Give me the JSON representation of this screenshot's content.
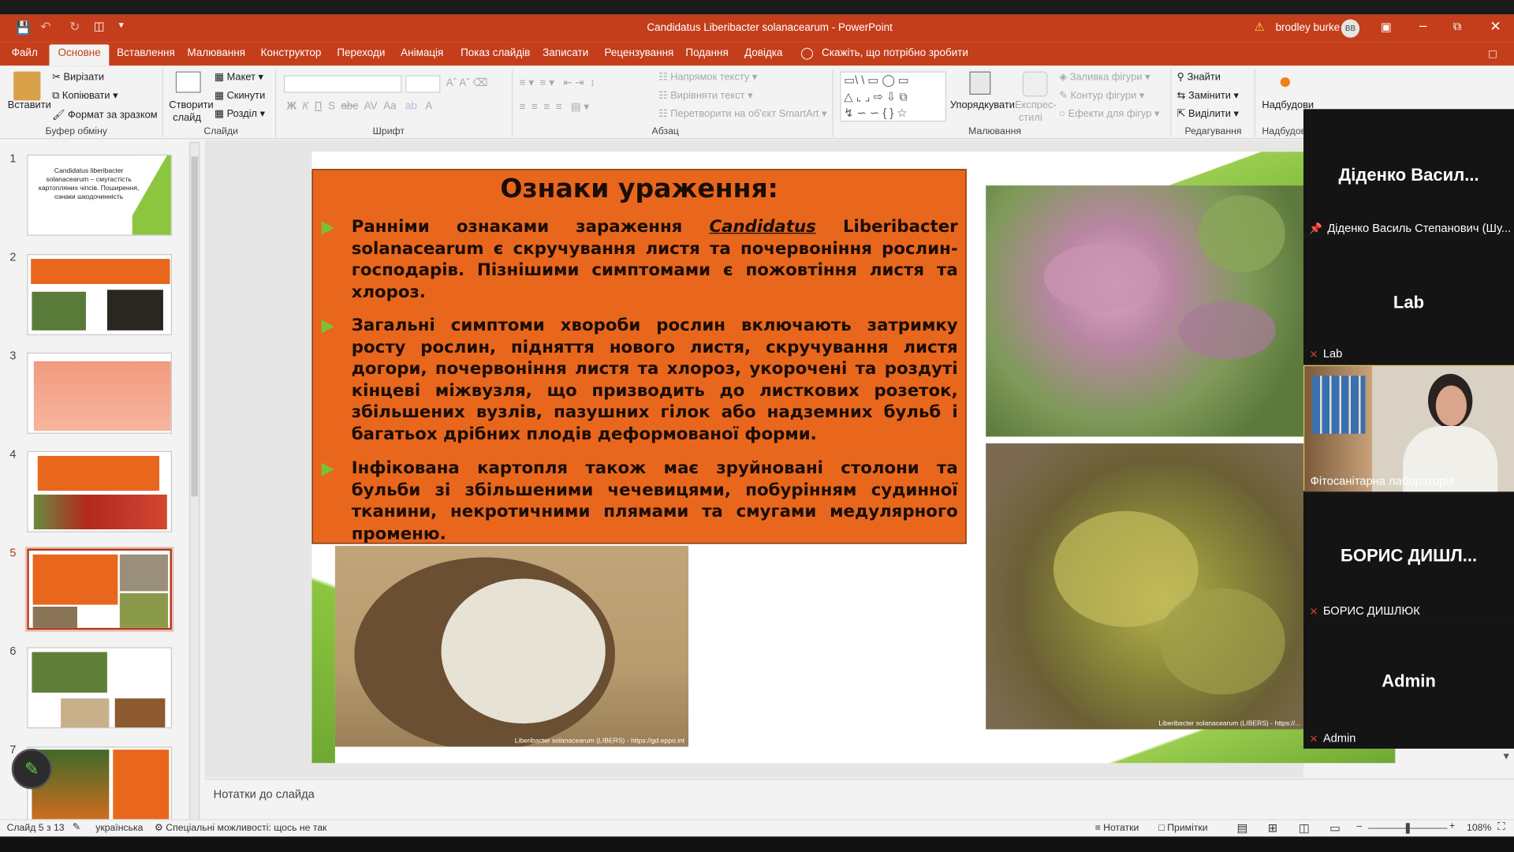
{
  "window": {
    "title": "Candidatus Liberibacter solanacearum  -  PowerPoint",
    "user": "brodley burke",
    "user_initials": "BB"
  },
  "tabs": [
    "Файл",
    "Основне",
    "Вставлення",
    "Малювання",
    "Конструктор",
    "Переходи",
    "Анімація",
    "Показ слайдів",
    "Записати",
    "Рецензування",
    "Подання",
    "Довідка"
  ],
  "active_tab": "Основне",
  "tell_me": "Скажіть, що потрібно зробити",
  "ribbon": {
    "paste": "Вставити",
    "cut": "Вирізати",
    "copy": "Копіювати",
    "format_painter": "Формат за зразком",
    "clipboard": "Буфер обміну",
    "new_slide": "Створити",
    "new_slide2": "слайд",
    "layout": "Макет",
    "reset": "Скинути",
    "section": "Розділ",
    "slides": "Слайди",
    "font": "Шрифт",
    "paragraph": "Абзац",
    "text_direction": "Напрямок тексту",
    "align_text": "Вирівняти текст",
    "smartart": "Перетворити на об'єкт SmartArt",
    "arrange": "Упорядкувати",
    "quick_styles": "Експрес-",
    "quick_styles2": "стилі",
    "shape_fill": "Заливка фігури",
    "shape_outline": "Контур фігури",
    "shape_effects": "Ефекти для фігур",
    "drawing": "Малювання",
    "find": "Знайти",
    "replace": "Замінити",
    "select": "Виділити",
    "editing": "Редагування",
    "addins": "Надбудови",
    "addins_group": "Надбудов"
  },
  "thumbnails": [
    {
      "num": "1",
      "text": "Candidatus liberibacter solanacearum – смугастість картопляних чіпсів. Поширення, ознаки шкодочинність"
    },
    {
      "num": "2"
    },
    {
      "num": "3"
    },
    {
      "num": "4"
    },
    {
      "num": "5",
      "selected": true
    },
    {
      "num": "6"
    },
    {
      "num": "7"
    }
  ],
  "slide": {
    "heading": "Ознаки ураження:",
    "bullet1_a": "Ранніми ознаками зараження ",
    "bullet1_italic": "Candidatus",
    "bullet1_b": " Liberibacter solanacearum є скручування листя та почервоніння рослин-господарів. Пізнішими симптомами є пожовтіння листя та хлороз.",
    "bullet2": "Загальні симптоми хвороби рослин включають затримку росту рослин, підняття нового листя, скручування листя догори, почервоніння листя та хлороз, укорочені та роздуті кінцеві міжвузля, що призводить до листкових розеток, збільшених вузлів, пазушних гілок або надземних бульб і багатьох дрібних плодів деформованої форми.",
    "bullet3": "Інфікована картопля також має зруйновані столони та бульби зі збільшеними чечевицями, побурінням судинної тканини, некротичними плямами та смугами медулярного променю.",
    "caption_tuber": "Liberibacter solanacearum (LIBERS) - https://gd.eppo.int",
    "caption_plant": "Liberibacter solanacearum (LIBERS) - https://..."
  },
  "notes_placeholder": "Нотатки до слайда",
  "status": {
    "slide": "Слайд 5 з 13",
    "language": "українська",
    "accessibility": "Спеціальні можливості: щось не так",
    "notes": "Нотатки",
    "comments": "Примітки",
    "zoom": "108%"
  },
  "participants": [
    {
      "display": "Діденко  Васил...",
      "label": "Діденко Василь Степанович (Шу..."
    },
    {
      "display": "Lab",
      "label": "Lab"
    },
    {
      "display": "",
      "label": "Фітосанітарна лабораторія"
    },
    {
      "display": "БОРИС  ДИШЛ...",
      "label": "БОРИС ДИШЛЮК"
    },
    {
      "display": "Admin",
      "label": "Admin"
    }
  ],
  "colors": {
    "accent": "#c43e1c",
    "slide_box": "#e8671d",
    "bullet": "#7cc03a"
  }
}
